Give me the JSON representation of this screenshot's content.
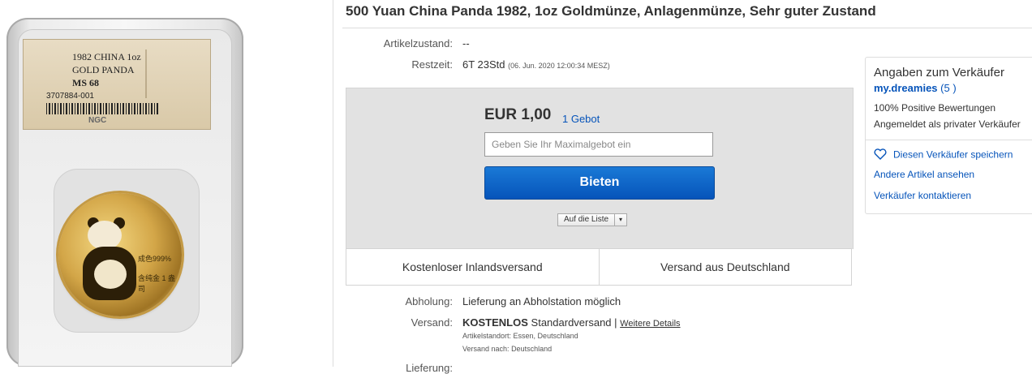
{
  "image": {
    "label_line1": "1982 CHINA 1oz",
    "label_line2": "GOLD PANDA",
    "label_grade": "MS 68",
    "label_cert": "3707884-001",
    "label_logo": "NGC",
    "coin_text1": "成色999%",
    "coin_text2": "含纯金 1 盎司"
  },
  "listing": {
    "title": "500 Yuan China Panda 1982, 1oz Goldmünze, Anlagenmünze, Sehr guter Zustand",
    "condition_label": "Artikelzustand:",
    "condition_value": "--",
    "time_label": "Restzeit:",
    "time_value": "6T 23Std",
    "time_end": "(06. Jun. 2020   12:00:34 MESZ)"
  },
  "bid": {
    "price": "EUR 1,00",
    "bids_count": "1 Gebot",
    "input_placeholder": "Geben Sie Ihr Maximalgebot ein",
    "bid_button": "Bieten",
    "watchlist_label": "Auf die Liste",
    "watchlist_caret": "▾"
  },
  "shipping_strip": {
    "cell1": "Kostenloser Inlandsversand",
    "cell2": "Versand aus Deutschland"
  },
  "details": {
    "pickup_label": "Abholung:",
    "pickup_value": "Lieferung an Abholstation möglich",
    "shipping_label": "Versand:",
    "shipping_free": "KOSTENLOS",
    "shipping_type": "Standardversand |",
    "shipping_more": "Weitere Details",
    "location_label": "Artikelstandort:",
    "location_value": "Essen, Deutschland",
    "ships_to_label": "Versand nach:",
    "ships_to_value": "Deutschland",
    "next_row_partial": "Lieferung:"
  },
  "seller": {
    "heading": "Angaben zum Verkäufer",
    "name": "my.dreamies",
    "score_open": "(",
    "score": "5",
    "score_close": ")",
    "positive": "100% Positive Bewertungen",
    "registered": "Angemeldet als privater Verkäufer",
    "save_link": "Diesen Verkäufer speichern",
    "other_items_link": "Andere Artikel ansehen",
    "contact_link": "Verkäufer kontaktieren"
  },
  "colors": {
    "link": "#0654ba",
    "bid_button": "#0654ba",
    "bid_box_bg": "#e2e2e2"
  }
}
